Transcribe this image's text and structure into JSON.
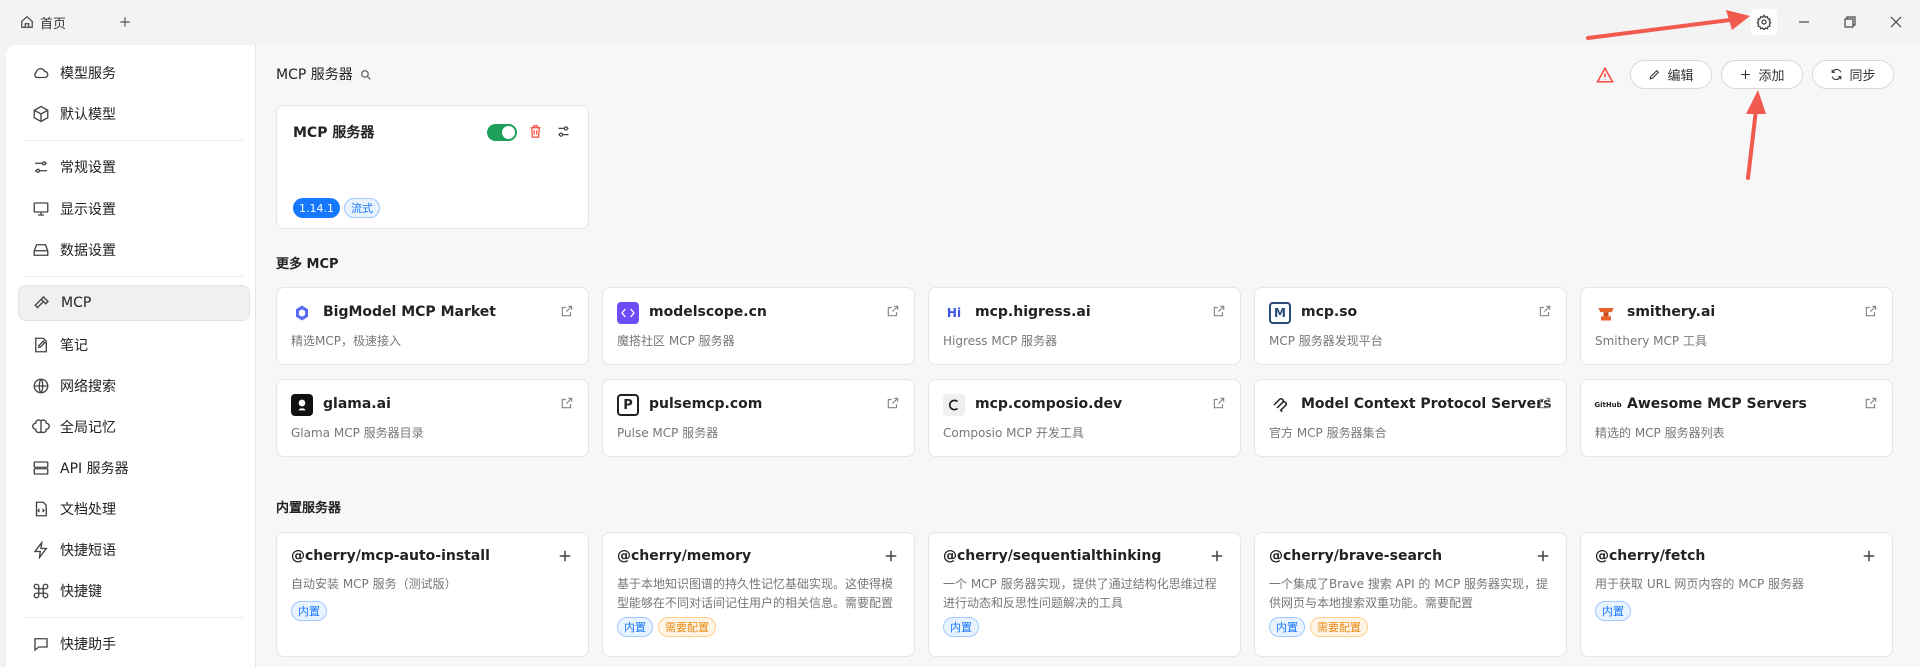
{
  "titlebar": {
    "home_tab": "首页"
  },
  "sidebar": {
    "items": [
      {
        "label": "模型服务",
        "icon": "cloud-icon"
      },
      {
        "label": "默认模型",
        "icon": "cube-icon"
      },
      {
        "label": "常规设置",
        "icon": "sliders-icon"
      },
      {
        "label": "显示设置",
        "icon": "monitor-icon"
      },
      {
        "label": "数据设置",
        "icon": "hard-drive-icon"
      },
      {
        "label": "MCP",
        "icon": "hammer-icon"
      },
      {
        "label": "笔记",
        "icon": "note-icon"
      },
      {
        "label": "网络搜索",
        "icon": "globe-icon"
      },
      {
        "label": "全局记忆",
        "icon": "brain-icon"
      },
      {
        "label": "API 服务器",
        "icon": "server-icon"
      },
      {
        "label": "文档处理",
        "icon": "file-code-icon"
      },
      {
        "label": "快捷短语",
        "icon": "zap-icon"
      },
      {
        "label": "快捷键",
        "icon": "command-icon"
      },
      {
        "label": "快捷助手",
        "icon": "message-icon"
      }
    ]
  },
  "header": {
    "title": "MCP 服务器",
    "edit_label": "编辑",
    "add_label": "添加",
    "sync_label": "同步"
  },
  "server": {
    "name": "MCP 服务器",
    "version": "1.14.1",
    "mode": "流式"
  },
  "more_mcp": {
    "title": "更多 MCP",
    "items": [
      {
        "name": "BigModel MCP Market",
        "desc": "精选MCP，极速接入",
        "icon": "bigmodel-logo-icon"
      },
      {
        "name": "modelscope.cn",
        "desc": "魔搭社区 MCP 服务器",
        "icon": "modelscope-logo-icon"
      },
      {
        "name": "mcp.higress.ai",
        "desc": "Higress MCP 服务器",
        "icon": "higress-logo-icon"
      },
      {
        "name": "mcp.so",
        "desc": "MCP 服务器发现平台",
        "icon": "mcpso-logo-icon"
      },
      {
        "name": "smithery.ai",
        "desc": "Smithery MCP 工具",
        "icon": "smithery-logo-icon"
      },
      {
        "name": "glama.ai",
        "desc": "Glama MCP 服务器目录",
        "icon": "glama-logo-icon"
      },
      {
        "name": "pulsemcp.com",
        "desc": "Pulse MCP 服务器",
        "icon": "pulse-logo-icon"
      },
      {
        "name": "mcp.composio.dev",
        "desc": "Composio MCP 开发工具",
        "icon": "composio-logo-icon"
      },
      {
        "name": "Model Context Protocol Servers",
        "desc": "官方 MCP 服务器集合",
        "icon": "mcp-logo-icon"
      },
      {
        "name": "Awesome MCP Servers",
        "desc": "精选的 MCP 服务器列表",
        "icon": "github-logo-icon"
      }
    ]
  },
  "logo_text": {
    "higress": "Hi",
    "mcpso": "M",
    "pulse": "P",
    "github": "GitHub"
  },
  "builtin": {
    "title": "内置服务器",
    "items": [
      {
        "name": "@cherry/mcp-auto-install",
        "desc": "自动安装 MCP 服务（测试版）",
        "badges": [
          "内置"
        ]
      },
      {
        "name": "@cherry/memory",
        "desc": "基于本地知识图谱的持久性记忆基础实现。这使得模型能够在不同对话间记住用户的相关信息。需要配置 MEMORY_FILE_PATH 环境变量。",
        "badges": [
          "内置",
          "需要配置"
        ]
      },
      {
        "name": "@cherry/sequentialthinking",
        "desc": "一个 MCP 服务器实现，提供了通过结构化思维过程进行动态和反思性问题解决的工具",
        "badges": [
          "内置"
        ]
      },
      {
        "name": "@cherry/brave-search",
        "desc": "一个集成了Brave 搜索 API 的 MCP 服务器实现，提供网页与本地搜索双重功能。需要配置 BRAVE_API_KEY 环境变量",
        "badges": [
          "内置",
          "需要配置"
        ]
      },
      {
        "name": "@cherry/fetch",
        "desc": "用于获取 URL 网页内容的 MCP 服务器",
        "badges": [
          "内置"
        ]
      }
    ]
  },
  "colors": {
    "accent_green": "#1da05b",
    "badge_blue": "#1677ff",
    "warning_red": "#f5483b",
    "annotation_arrow": "#f15a4e"
  }
}
